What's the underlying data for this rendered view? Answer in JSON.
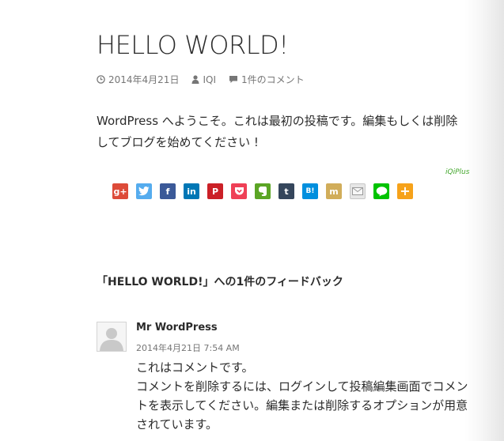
{
  "post": {
    "title": "HELLO WORLD!",
    "date": "2014年4月21日",
    "author": "IQI",
    "comments_link": "1件のコメント",
    "content": "WordPress へようこそ。これは最初の投稿です。編集もしくは削除してブログを始めてください !"
  },
  "share": {
    "credit": "iQiPlus",
    "buttons": [
      {
        "name": "google-plus",
        "label": "g+",
        "color": "#dd4b39"
      },
      {
        "name": "twitter",
        "label": "",
        "color": "#55acee"
      },
      {
        "name": "facebook",
        "label": "f",
        "color": "#3b5998"
      },
      {
        "name": "linkedin",
        "label": "in",
        "color": "#0077b5"
      },
      {
        "name": "pinterest",
        "label": "P",
        "color": "#cb2027"
      },
      {
        "name": "pocket",
        "label": "",
        "color": "#ef4056"
      },
      {
        "name": "evernote",
        "label": "",
        "color": "#5ba525"
      },
      {
        "name": "tumblr",
        "label": "t",
        "color": "#35465c"
      },
      {
        "name": "hatena",
        "label": "B!",
        "color": "#008fde"
      },
      {
        "name": "mixi",
        "label": "m",
        "color": "#d1ad5a"
      },
      {
        "name": "email",
        "label": "",
        "color": "#e6e6e6"
      },
      {
        "name": "line",
        "label": "",
        "color": "#00c300"
      },
      {
        "name": "more",
        "label": "+",
        "color": "#f6a21a"
      }
    ]
  },
  "comments": {
    "title": "「HELLO WORLD!」への1件のフィードバック",
    "items": [
      {
        "author": "Mr WordPress",
        "date": "2014年4月21日 7:54 AM",
        "lines": [
          "これはコメントです。",
          "コメントを削除するには、ログインして投稿編集画面でコメントを表示してください。編集または削除するオプションが用意されています。"
        ]
      }
    ]
  }
}
